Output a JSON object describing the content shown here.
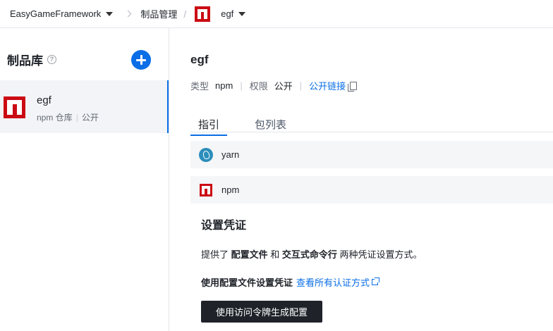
{
  "breadcrumb": {
    "project": "EasyGameFramework",
    "section": "制品管理",
    "repo": "egf"
  },
  "sidebar": {
    "title": "制品库",
    "help_icon": "?",
    "items": [
      {
        "name": "egf",
        "type": "npm 仓库",
        "visibility": "公开"
      }
    ]
  },
  "main": {
    "title": "egf",
    "meta": {
      "type_label": "类型",
      "type_value": "npm",
      "perm_label": "权限",
      "perm_value": "公开",
      "public_link": "公开链接"
    },
    "tabs": [
      {
        "label": "指引"
      },
      {
        "label": "包列表"
      }
    ],
    "package_managers": [
      {
        "label": "yarn"
      },
      {
        "label": "npm"
      }
    ],
    "credentials": {
      "title": "设置凭证",
      "desc_prefix": "提供了 ",
      "desc_config": "配置文件",
      "desc_and": " 和 ",
      "desc_cli": "交互式命令行",
      "desc_suffix": " 两种凭证设置方式。",
      "config_heading": "使用配置文件设置凭证",
      "view_all_link": "查看所有认证方式",
      "generate_button": "使用访问令牌生成配置"
    }
  },
  "colors": {
    "accent": "#0a6ee6",
    "npm_red": "#cb0b14",
    "dark_button": "#1f2329"
  }
}
